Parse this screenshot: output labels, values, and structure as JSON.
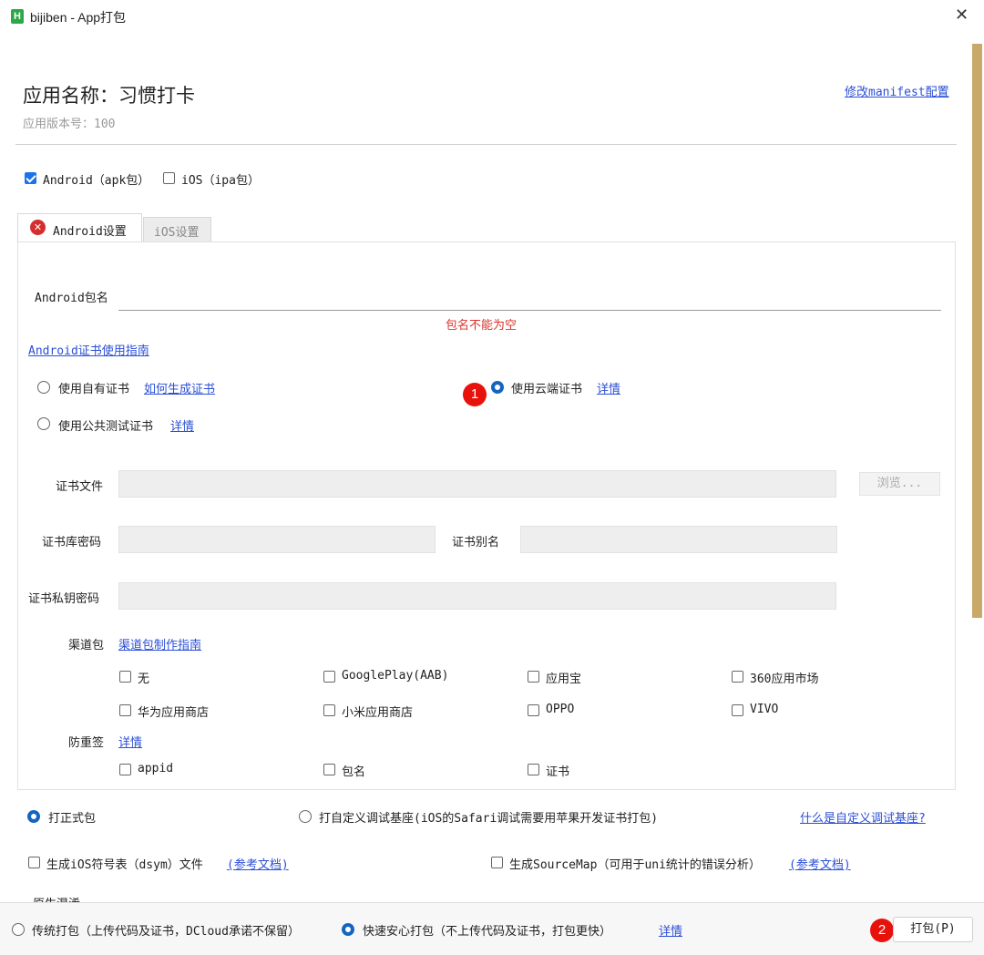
{
  "window": {
    "title": "bijiben - App打包",
    "app_icon_letter": "H",
    "close_glyph": "✕"
  },
  "header": {
    "app_name": "应用名称：习惯打卡",
    "version": "应用版本号：100",
    "manifest_link": "修改manifest配置"
  },
  "platforms": {
    "android": {
      "label": "Android（apk包）",
      "checked": true
    },
    "ios": {
      "label": "iOS（ipa包）",
      "checked": false
    }
  },
  "tabs": [
    {
      "label": "Android设置",
      "active": true,
      "error": true
    },
    {
      "label": "iOS设置",
      "active": false
    }
  ],
  "android": {
    "package_label": "Android包名",
    "package_value": "",
    "package_error": "包名不能为空",
    "cert_guide_link": "Android证书使用指南",
    "cert_options": {
      "own": {
        "label": "使用自有证书",
        "link": "如何生成证书",
        "selected": false
      },
      "cloud": {
        "label": "使用云端证书",
        "link": "详情",
        "selected": true
      },
      "public": {
        "label": "使用公共测试证书",
        "link": "详情",
        "selected": false
      }
    },
    "cert_file_label": "证书文件",
    "browse_button": "浏览...",
    "keystore_password_label": "证书库密码",
    "alias_label": "证书别名",
    "private_key_password_label": "证书私钥密码",
    "channel_label": "渠道包",
    "channel_guide_link": "渠道包制作指南",
    "channels": [
      {
        "label": "无",
        "checked": false
      },
      {
        "label": "GooglePlay(AAB)",
        "checked": false
      },
      {
        "label": "应用宝",
        "checked": false
      },
      {
        "label": "360应用市场",
        "checked": false
      },
      {
        "label": "华为应用商店",
        "checked": false
      },
      {
        "label": "小米应用商店",
        "checked": false
      },
      {
        "label": "OPPO",
        "checked": false
      },
      {
        "label": "VIVO",
        "checked": false
      }
    ],
    "anti_repack_label": "防重签",
    "anti_repack_link": "详情",
    "anti_repack_options": [
      {
        "label": "appid",
        "checked": false
      },
      {
        "label": "包名",
        "checked": false
      },
      {
        "label": "证书",
        "checked": false
      }
    ]
  },
  "build_type": {
    "release": {
      "label": "打正式包",
      "selected": true
    },
    "custom_base": {
      "label": "打自定义调试基座(iOS的Safari调试需要用苹果开发证书打包)",
      "selected": false
    },
    "custom_base_link": "什么是自定义调试基座?"
  },
  "extras": {
    "dsym": {
      "label": "生成iOS符号表（dsym）文件",
      "link": "(参考文档)",
      "checked": false
    },
    "sourcemap": {
      "label": "生成SourceMap（可用于uni统计的错误分析）",
      "link": "(参考文档)",
      "checked": false
    },
    "partial_section": "原生混淆"
  },
  "footer": {
    "traditional": {
      "label": "传统打包（上传代码及证书，DCloud承诺不保留）",
      "selected": false
    },
    "fast": {
      "label": "快速安心打包（不上传代码及证书，打包更快）",
      "selected": true
    },
    "details_link": "详情",
    "build_button": "打包(P)"
  },
  "annotations": {
    "badge1": "1",
    "badge2": "2"
  },
  "colors": {
    "link": "#2b4fd6",
    "error": "#d9342b",
    "checkbox_checked": "#1a73e8",
    "radio_selected": "#1565c0",
    "badge": "#e8120c",
    "app_icon": "#2aa84a"
  }
}
